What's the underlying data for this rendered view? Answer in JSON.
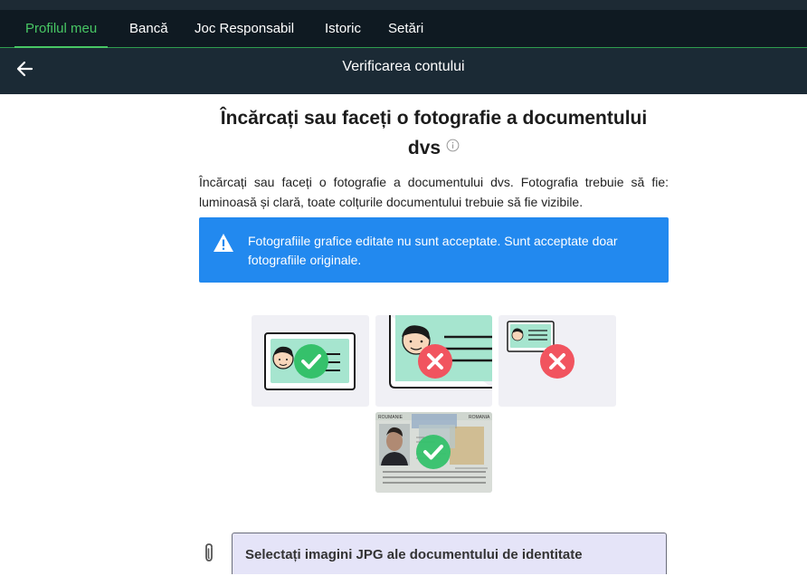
{
  "nav": {
    "tabs": [
      {
        "label": "Profilul meu"
      },
      {
        "label": "Bancă"
      },
      {
        "label": "Joc Responsabil"
      },
      {
        "label": "Istoric"
      },
      {
        "label": "Setări"
      }
    ],
    "active_color": "#48c764"
  },
  "subheader": {
    "title": "Verificarea contului",
    "back_icon": "arrow-left-icon"
  },
  "main": {
    "heading_line1": "Încărcați sau faceți o fotografie a documentului",
    "heading_line2": "dvs",
    "description": "Încărcați sau faceți o fotografie a documentului dvs. Fotografia trebuie să fie: luminoasă și clară, toate colțurile documentului trebuie să fie vizibile.",
    "alert": {
      "text": "Fotografiile grafice editate nu sunt acceptate. Sunt acceptate doar fotografiile originale.",
      "color": "#2289ef"
    },
    "examples": [
      {
        "kind": "correct-framing",
        "status": "accepted"
      },
      {
        "kind": "too-close",
        "status": "rejected"
      },
      {
        "kind": "too-far",
        "status": "rejected"
      },
      {
        "kind": "real-id-photo",
        "status": "accepted",
        "card_texts": [
          "ROUMANIE",
          "ROMANIA"
        ]
      }
    ],
    "upload": {
      "label": "Selectați imagini JPG ale documentului de identitate",
      "icon": "paperclip-icon"
    }
  }
}
